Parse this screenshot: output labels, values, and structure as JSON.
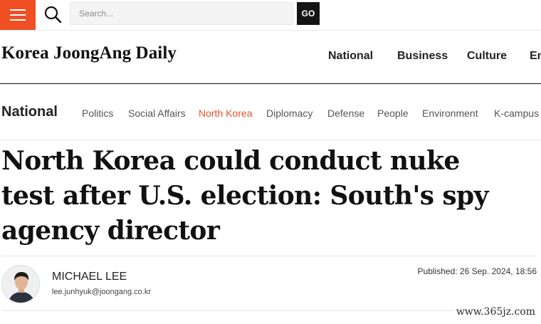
{
  "header": {
    "menu_icon": "hamburger-menu-icon",
    "search_icon": "search-icon",
    "search_placeholder": "Search...",
    "go_label": "GO",
    "accent_color": "#f04e23"
  },
  "masthead": {
    "logo": "Korea JoongAng Daily",
    "nav": [
      {
        "label": "National"
      },
      {
        "label": "Business"
      },
      {
        "label": "Culture"
      },
      {
        "label": "En"
      }
    ]
  },
  "section": {
    "title": "National",
    "subnav": [
      {
        "label": "Politics"
      },
      {
        "label": "Social Affairs"
      },
      {
        "label": "North Korea",
        "active": true
      },
      {
        "label": "Diplomacy"
      },
      {
        "label": "Defense"
      },
      {
        "label": "People"
      },
      {
        "label": "Environment"
      },
      {
        "label": "K-campus"
      }
    ],
    "active_color": "#e8512b"
  },
  "article": {
    "headline": "North Korea could conduct nuke test after U.S. election: South's spy agency director",
    "author": {
      "name": "MICHAEL LEE",
      "email": "lee.junhyuk@joongang.co.kr",
      "avatar_icon": "author-portrait"
    },
    "published": "Published: 26 Sep. 2024, 18:56"
  },
  "watermark": "www.365jz.com"
}
